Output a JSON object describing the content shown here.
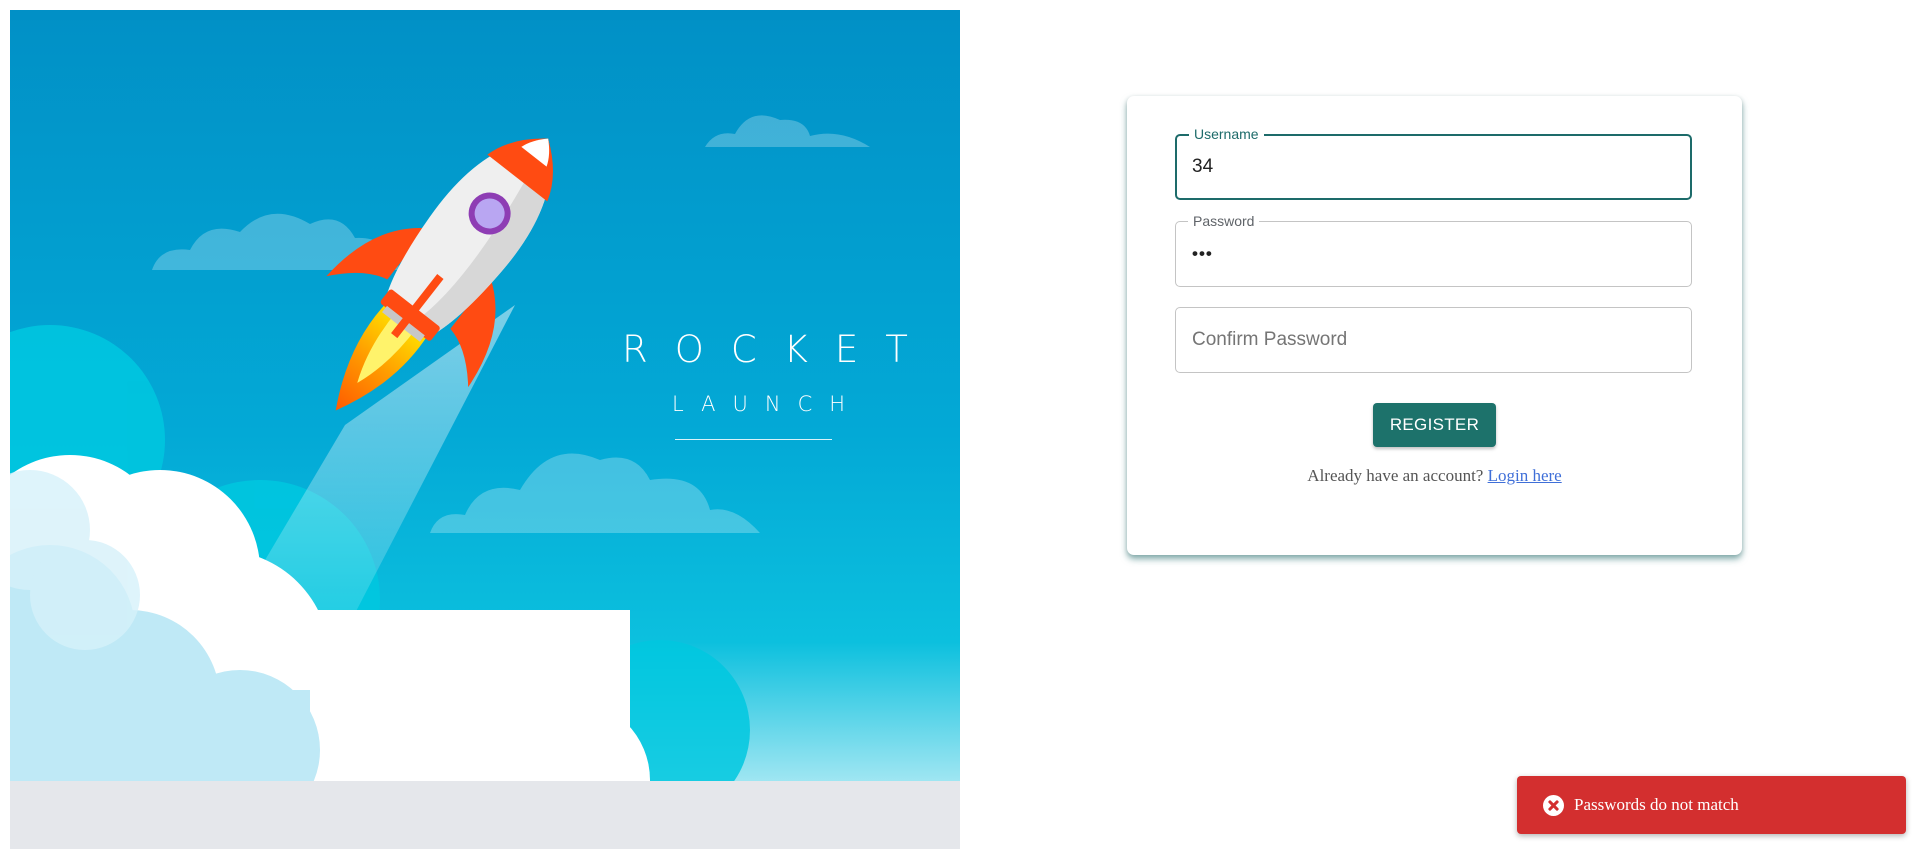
{
  "hero": {
    "title": "ROCKET",
    "subtitle": "LAUNCH"
  },
  "form": {
    "username": {
      "label": "Username",
      "value": "34"
    },
    "password": {
      "label": "Password",
      "masked_value": "•••"
    },
    "confirm_password": {
      "placeholder": "Confirm Password",
      "value": ""
    },
    "register_label": "REGISTER",
    "login_prompt": "Already have an account?",
    "login_link": "Login here"
  },
  "toast": {
    "icon": "error-circle-icon",
    "message": "Passwords do not match"
  },
  "colors": {
    "primary": "#1d726b",
    "focus_border": "#1d6b6a",
    "error": "#d32f2f",
    "link": "#3f6fd8",
    "sky_top": "#0190c6",
    "sky_bottom": "#08b6d8"
  }
}
